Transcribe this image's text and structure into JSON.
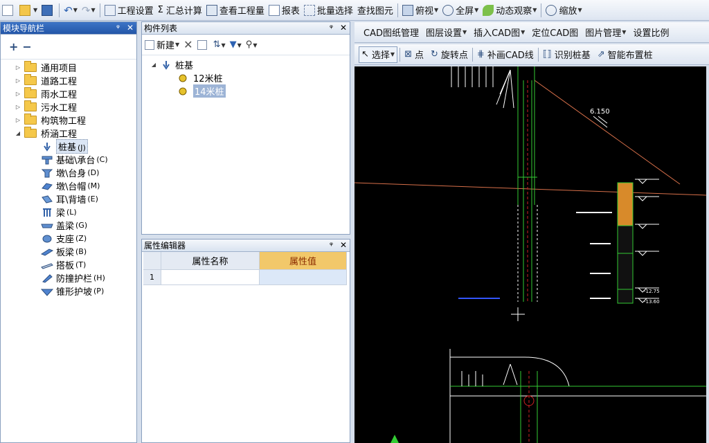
{
  "toolbar": {
    "items": [
      "工程设置",
      "汇总计算",
      "查看工程量",
      "报表",
      "批量选择",
      "查找图元",
      "俯视",
      "全屏",
      "动态观察",
      "缩放"
    ]
  },
  "nav_panel": {
    "title": "模块导航栏",
    "pin": "ᵠ",
    "folders": [
      "通用项目",
      "道路工程",
      "雨水工程",
      "污水工程",
      "构筑物工程",
      "桥涵工程"
    ],
    "bridge_items": [
      {
        "label": "桩基",
        "key": "(J)"
      },
      {
        "label": "基础\\承台",
        "key": "(C)"
      },
      {
        "label": "墩\\台身",
        "key": "(D)"
      },
      {
        "label": "墩\\台帽",
        "key": "(M)"
      },
      {
        "label": "耳\\背墙",
        "key": "(E)"
      },
      {
        "label": "梁",
        "key": "(L)"
      },
      {
        "label": "盖梁",
        "key": "(G)"
      },
      {
        "label": "支座",
        "key": "(Z)"
      },
      {
        "label": "板梁",
        "key": "(B)"
      },
      {
        "label": "搭板",
        "key": "(T)"
      },
      {
        "label": "防撞护栏",
        "key": "(H)"
      },
      {
        "label": "锥形护坡",
        "key": "(P)"
      }
    ]
  },
  "component_panel": {
    "title": "构件列表",
    "new_label": "新建",
    "root": "桩基",
    "children": [
      "12米桩",
      "14米桩"
    ],
    "selected_child": "14米桩"
  },
  "property_panel": {
    "title": "属性编辑器",
    "col_name": "属性名称",
    "col_value": "属性值",
    "row_num": "1"
  },
  "cad_toolbar": {
    "items": [
      "CAD图纸管理",
      "图层设置",
      "插入CAD图",
      "定位CAD图",
      "图片管理",
      "设置比例"
    ]
  },
  "draw_toolbar": {
    "items": [
      "选择",
      "点",
      "旋转点",
      "补画CAD线",
      "识别桩基",
      "智能布置桩"
    ]
  },
  "cad_drawing": {
    "elevation_label": "6.150",
    "level_marks": [
      "-12.75",
      "-13.60"
    ]
  },
  "colors": {
    "title_active": "#2356a8",
    "header_value": "#f2c86a",
    "cad_green": "#33cc33",
    "cad_orange": "#d8704a"
  }
}
